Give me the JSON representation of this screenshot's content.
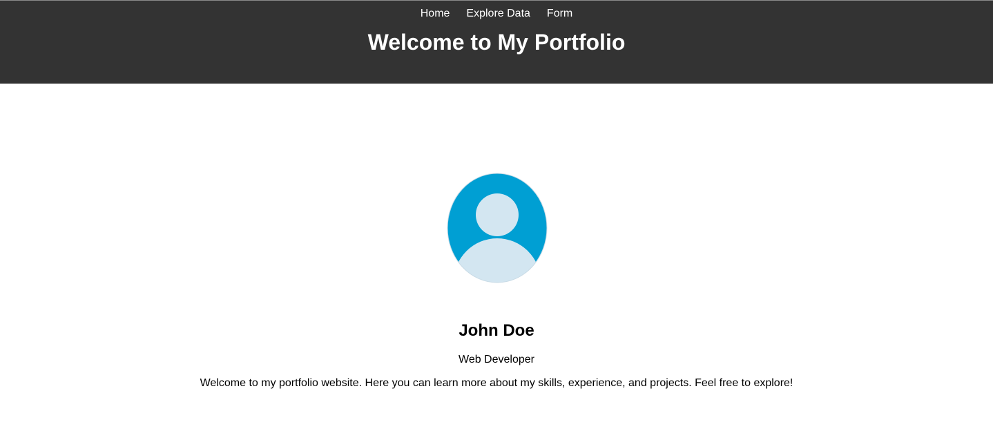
{
  "header": {
    "nav": [
      {
        "label": "Home"
      },
      {
        "label": "Explore Data"
      },
      {
        "label": "Form"
      }
    ],
    "title": "Welcome to My Portfolio"
  },
  "profile": {
    "avatar_icon": "user-avatar-icon",
    "name": "John Doe",
    "role": "Web Developer",
    "intro": "Welcome to my portfolio website. Here you can learn more about my skills, experience, and projects. Feel free to explore!"
  },
  "colors": {
    "header_bg": "#333333",
    "avatar_bg": "#009fd3",
    "avatar_figure": "#d3e6f1"
  }
}
